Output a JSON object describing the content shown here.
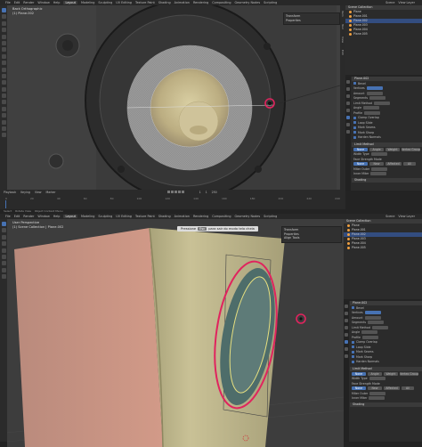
{
  "top": {
    "menus": [
      "File",
      "Edit",
      "Render",
      "Window",
      "Help"
    ],
    "workspaces": [
      "Layout",
      "Modeling",
      "Sculpting",
      "UV Editing",
      "Texture Paint",
      "Shading",
      "Animation",
      "Rendering",
      "Compositing",
      "Geometry Nodes",
      "Scripting"
    ],
    "active_workspace": "Layout",
    "scene": "Scene",
    "view_layer": "View Layer"
  },
  "viewport1": {
    "view_name": "Back Orthographic",
    "collection": "(1) Plane.002",
    "npanel_items": [
      "Transform",
      "Properties"
    ],
    "tabs": [
      "Item",
      "Tool",
      "View",
      "Edit"
    ]
  },
  "viewport2": {
    "view_name": "User Perspective",
    "collection": "(1) Scene Collection | Plane.002",
    "npanel_items": [
      "Transform",
      "Properties",
      "Align Tools"
    ],
    "tooltip_pre": "Pressione",
    "tooltip_key": "Esc",
    "tooltip_post": "para sair do modo tela cheia"
  },
  "outliner": {
    "title": "Scene Collection",
    "rows": [
      "Plane",
      "Plane.001",
      "Plane.002",
      "Plane.003",
      "Plane.004",
      "Plane.005"
    ]
  },
  "properties": {
    "object_name": "Plane.002",
    "modifier": "Bevel",
    "rows": [
      "Vertices",
      "Amount",
      "Segments",
      "Limit Method",
      "Angle",
      "Profile",
      "Clamp Overlap",
      "Loop Slide",
      "Mark Seams",
      "Mark Sharp",
      "Harden Normals"
    ],
    "limit_method_label": "Limit Method",
    "limit_options": [
      "None",
      "Angle",
      "Weight",
      "Vertex Group"
    ],
    "width_type_label": "Width Type",
    "face_strength_label": "Face Strength Mode",
    "face_options": [
      "None",
      "New",
      "Affected",
      "All"
    ],
    "miter_label": "Miter Outer",
    "inner_label": "Inner Miter",
    "shading_label": "Shading"
  },
  "timeline": {
    "labels": [
      "Playback",
      "Keying",
      "View",
      "Marker"
    ],
    "frame_start": "1",
    "frame_end": "250",
    "current_frame": "1",
    "ticks": [
      "0",
      "20",
      "40",
      "60",
      "80",
      "100",
      "120",
      "140",
      "160",
      "180",
      "200",
      "220",
      "240"
    ]
  },
  "status": {
    "left": "Select",
    "mid": "Rotate View",
    "right": "Object Context Menu"
  },
  "colors": {
    "accent": "#4772b3",
    "highlight_circle": "#e0245e",
    "speaker_cone": "#d4c79a",
    "panel_wall": "#d99a8a"
  }
}
